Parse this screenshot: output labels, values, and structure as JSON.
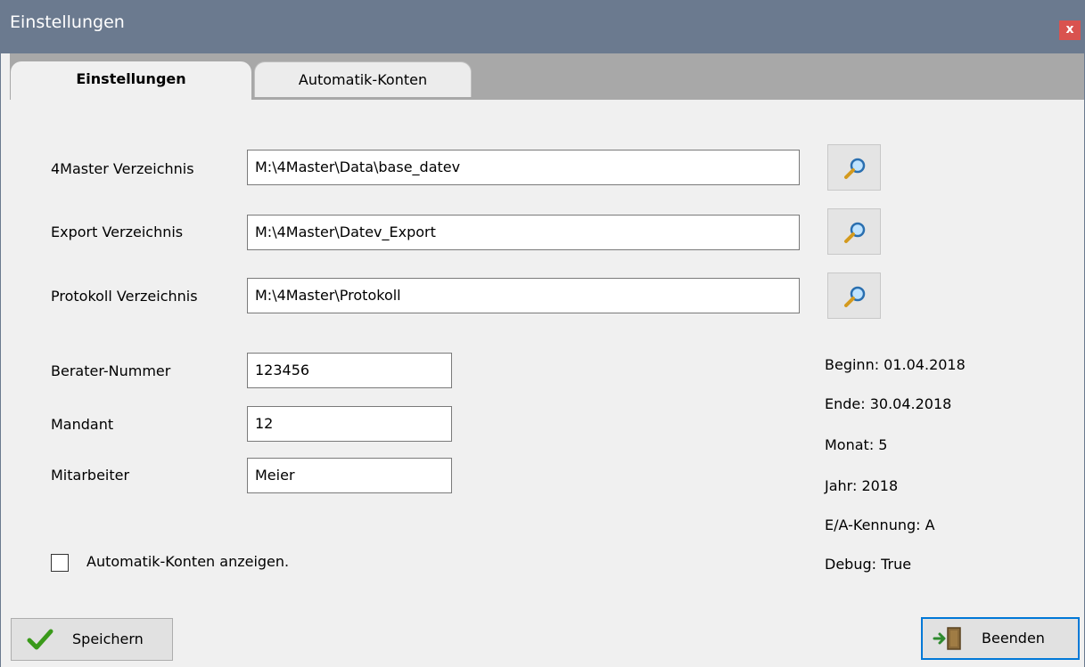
{
  "window": {
    "title": "Einstellungen",
    "close_label": "x"
  },
  "tabs": [
    {
      "label": "Einstellungen",
      "active": true
    },
    {
      "label": "Automatik-Konten",
      "active": false
    }
  ],
  "paths": {
    "master": {
      "label": "4Master Verzeichnis",
      "value": "M:\\4Master\\Data\\base_datev"
    },
    "export": {
      "label": "Export Verzeichnis",
      "value": "M:\\4Master\\Datev_Export"
    },
    "protokoll": {
      "label": "Protokoll Verzeichnis",
      "value": "M:\\4Master\\Protokoll"
    }
  },
  "fields": {
    "berater": {
      "label": "Berater-Nummer",
      "value": "123456"
    },
    "mandant": {
      "label": "Mandant",
      "value": "12"
    },
    "mitarbeiter": {
      "label": "Mitarbeiter",
      "value": "Meier"
    }
  },
  "info": {
    "beginn": "Beginn: 01.04.2018",
    "ende": "Ende: 30.04.2018",
    "monat": "Monat: 5",
    "jahr": "Jahr: 2018",
    "kennung": "E/A-Kennung: A",
    "debug": "Debug: True"
  },
  "checkbox": {
    "label": "Automatik-Konten anzeigen.",
    "checked": false
  },
  "buttons": {
    "save": "Speichern",
    "exit": "Beenden"
  },
  "icons": {
    "browse": "magnifier-icon",
    "save": "checkmark-icon",
    "exit": "exit-door-icon"
  }
}
